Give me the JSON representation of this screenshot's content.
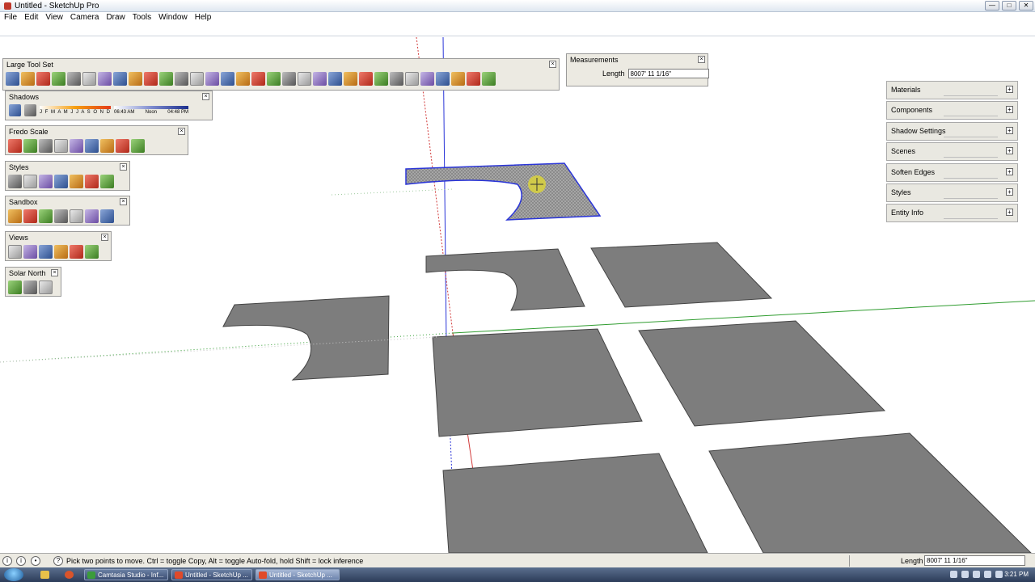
{
  "window": {
    "title": "Untitled - SketchUp Pro",
    "buttons": [
      "—",
      "□",
      "✕"
    ]
  },
  "menu": [
    "File",
    "Edit",
    "View",
    "Camera",
    "Draw",
    "Tools",
    "Window",
    "Help"
  ],
  "toolbars": {
    "large_tool_set": {
      "title": "Large Tool Set",
      "icons": [
        "select-icon",
        "component-icon",
        "paint-bucket-icon",
        "eraser-icon",
        "rectangle-icon",
        "line-icon",
        "circle-icon",
        "arc-icon",
        "polygon-icon",
        "freehand-icon",
        "move-icon",
        "push-pull-icon",
        "rotate-icon",
        "follow-me-icon",
        "scale-icon",
        "offset-icon",
        "tape-measure-icon",
        "dimension-icon",
        "protractor-icon",
        "text-icon",
        "axes-icon",
        "3d-text-icon",
        "orbit-icon",
        "pan-icon",
        "zoom-icon",
        "zoom-window-icon",
        "zoom-extents-icon",
        "previous-view-icon",
        "position-camera-icon",
        "walk-icon",
        "look-around-icon",
        "section-plane-icon"
      ]
    },
    "shadows": {
      "title": "Shadows",
      "months": "J F M A M J J A S O N D",
      "time_start": "06:43 AM",
      "time_mid": "Noon",
      "time_end": "04:48 PM"
    },
    "fredo_scale": {
      "title": "Fredo Scale",
      "icons": [
        "box-scale-icon",
        "planar-scale-icon",
        "stretch-icon",
        "taper-icon",
        "twist-icon",
        "bend-icon",
        "radial-bend-icon",
        "shear-icon",
        "undo-scale-icon"
      ]
    },
    "styles": {
      "title": "Styles",
      "icons": [
        "xray-icon",
        "back-edges-icon",
        "wireframe-icon",
        "hidden-line-icon",
        "shaded-icon",
        "shaded-textures-icon",
        "monochrome-icon"
      ]
    },
    "sandbox": {
      "title": "Sandbox",
      "icons": [
        "from-contours-icon",
        "from-scratch-icon",
        "smoove-icon",
        "stamp-icon",
        "drape-icon",
        "add-detail-icon",
        "flip-edge-icon"
      ]
    },
    "views": {
      "title": "Views",
      "icons": [
        "iso-view-icon",
        "top-view-icon",
        "front-view-icon",
        "right-view-icon",
        "back-view-icon",
        "left-view-icon"
      ]
    },
    "solar_north": {
      "title": "Solar North",
      "icons": [
        "toggle-north-icon",
        "set-north-icon",
        "enter-north-angle-icon"
      ]
    }
  },
  "measurements": {
    "title": "Measurements",
    "label": "Length",
    "value": "8007' 11 1/16\""
  },
  "tray": [
    "Materials",
    "Components",
    "Shadow Settings",
    "Scenes",
    "Soften Edges",
    "Styles",
    "Entity Info"
  ],
  "status": {
    "hint": "Pick two points to move.  Ctrl = toggle Copy, Alt = toggle Auto-fold, hold Shift = lock inference",
    "length_label": "Length",
    "length_value": "8007' 11 1/16\""
  },
  "taskbar": {
    "tasks": [
      "Camtasia Studio - Inf...",
      "Untitled - SketchUp ...",
      "Untitled - SketchUp ..."
    ],
    "clock": "3:21 PM"
  },
  "colors": {
    "face": "#7d7d7d",
    "selection": "#2a35d8",
    "axis_red": "#d23b3b",
    "axis_green": "#2f9c2f",
    "axis_blue": "#2a35d8",
    "panel": "#eceae2"
  }
}
